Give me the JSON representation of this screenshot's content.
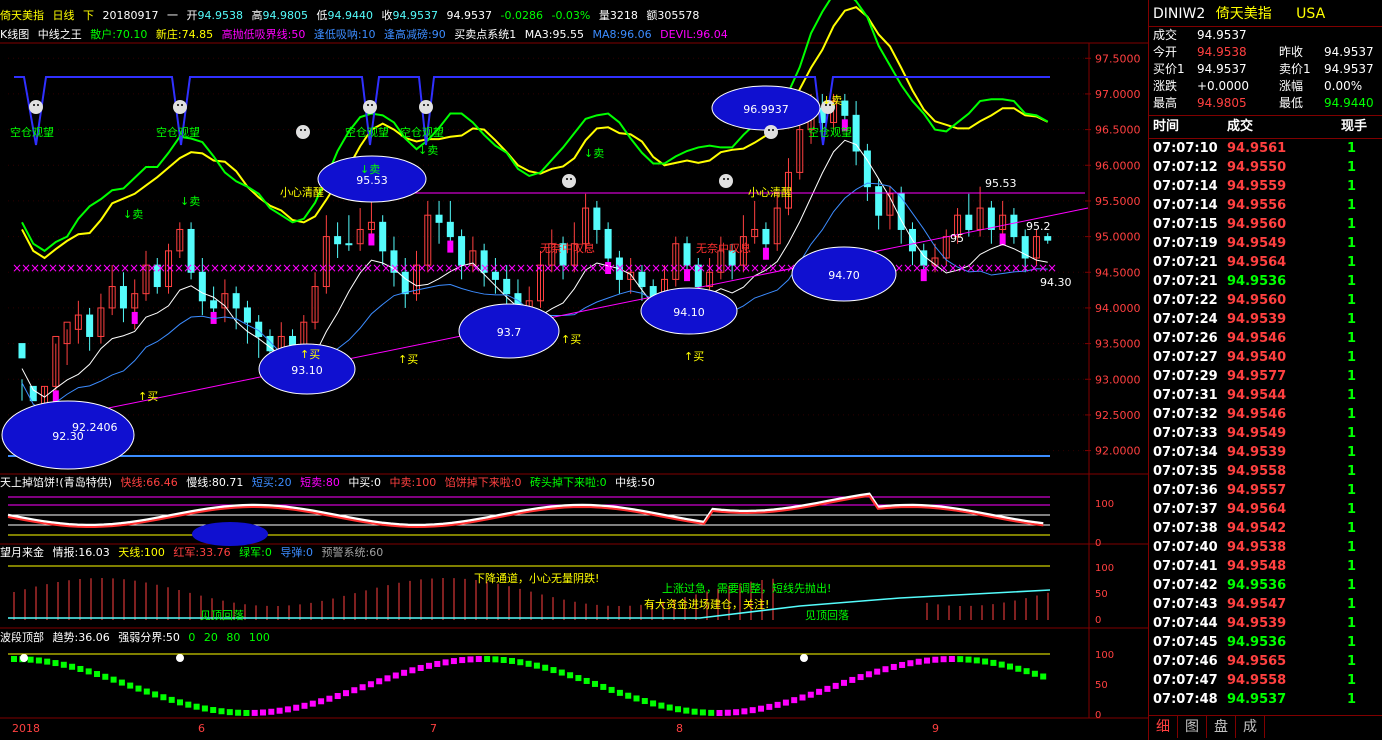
{
  "colors": {
    "up": "#ff4040",
    "down": "#54fcfc",
    "bull": "#ff3030",
    "bear": "#00ff00",
    "yellow": "#ffff00",
    "magenta": "#ff00ff",
    "grid": "#800000",
    "blue": "#3030ff"
  },
  "header": {
    "name": "倚天美指",
    "period": "日线",
    "mode": "下",
    "date": "20180917",
    "weekday": "一",
    "open_label": "开",
    "open": "94.9538",
    "high_label": "高",
    "high": "94.9805",
    "low_label": "低",
    "low": "94.9440",
    "close_label": "收",
    "close": "94.9537",
    "last": "94.9537",
    "change": "-0.0286",
    "change_pct": "-0.03%",
    "volume_label": "量",
    "volume": "3218",
    "amount_label": "额",
    "amount": "305578"
  },
  "indicator_main": {
    "prefix": "K线图",
    "name": "中线之王",
    "items": [
      "散户:70.10",
      "新庄:74.85",
      "高抛低吸界线:50",
      "逢低吸呐:10",
      "逢高减磅:90",
      "买卖点系统1",
      "MA3:95.55",
      "MA8:96.06",
      "DEVIL:96.04"
    ]
  },
  "price_axis": [
    "97.5000",
    "97.0000",
    "96.5000",
    "96.0000",
    "95.5000",
    "95.0000",
    "94.5000",
    "94.0000",
    "93.5000",
    "93.0000",
    "92.5000",
    "92.0000"
  ],
  "annotations": [
    {
      "text": "空仓观望",
      "kind": "green"
    },
    {
      "text": "空仓观望",
      "kind": "green"
    },
    {
      "text": "空仓观望",
      "kind": "green"
    },
    {
      "text": "空仓观望",
      "kind": "green"
    },
    {
      "text": "空仓观望",
      "kind": "green"
    },
    {
      "text": "小心清醒",
      "kind": "yellow"
    },
    {
      "text": "小心清醒",
      "kind": "yellow"
    },
    {
      "text": "无奈中叹息",
      "kind": "red"
    },
    {
      "text": "无奈中叹息",
      "kind": "red"
    },
    {
      "text": "↓卖",
      "kind": "green"
    },
    {
      "text": "↓卖",
      "kind": "green"
    },
    {
      "text": "↓卖",
      "kind": "green"
    },
    {
      "text": "↓卖",
      "kind": "green"
    },
    {
      "text": "↓卖",
      "kind": "green"
    },
    {
      "text": "↑买",
      "kind": "yellow"
    },
    {
      "text": "↑买",
      "kind": "yellow"
    },
    {
      "text": "↑买",
      "kind": "yellow"
    },
    {
      "text": "↑买",
      "kind": "yellow"
    },
    {
      "text": "↑买",
      "kind": "yellow"
    },
    {
      "text": "↓卖",
      "kind": "white"
    }
  ],
  "ellipse_labels": [
    "92.30",
    "93.10",
    "93.7",
    "94.10",
    "94.70",
    "95.53",
    "96.9937"
  ],
  "price_labels": [
    "92.2406",
    "95.53",
    "95.2",
    "95",
    "94.30"
  ],
  "panel2": {
    "title": "天上掉馅饼!(青岛特供)",
    "items": [
      "快线:66.46",
      "慢线:80.71",
      "短买:20",
      "短卖:80",
      "中买:0",
      "中卖:100",
      "馅饼掉下来啦:0",
      "砖头掉下来啦:0",
      "中线:50"
    ],
    "axis": [
      "100",
      "0"
    ]
  },
  "panel3": {
    "title": "望月来金",
    "items": [
      "情报:16.03",
      "天线:100",
      "红军:33.76",
      "绿军:0",
      "导弹:0",
      "预警系统:60"
    ],
    "axis": [
      "100",
      "50",
      "0"
    ],
    "notes": [
      "下降通道，小心无量阴跌!",
      "上涨过急，需要调整，短线先抛出!",
      "有大资金进场建仓，关注!",
      "见顶回落",
      "见顶回落"
    ]
  },
  "panel4": {
    "title": "波段顶部",
    "items": [
      "趋势:36.06",
      "强弱分界:50",
      "0",
      "20",
      "80",
      "100"
    ],
    "axis": [
      "100",
      "50",
      "0"
    ]
  },
  "x_axis": [
    "2018",
    "6",
    "7",
    "8",
    "9"
  ],
  "right": {
    "symbol": "DINIW2",
    "name": "倚天美指",
    "market": "USA",
    "quote": {
      "last_label": "成交",
      "last": "94.9537",
      "open_label": "今开",
      "open": "94.9538",
      "prev_label": "昨收",
      "prev": "94.9537",
      "bid_label": "买价1",
      "bid": "94.9537",
      "ask_label": "卖价1",
      "ask": "94.9537",
      "chg_label": "涨跌",
      "chg": "+0.0000",
      "chgpct_label": "涨幅",
      "chgpct": "0.00%",
      "high_label": "最高",
      "high": "94.9805",
      "low_label": "最低",
      "low": "94.9440"
    },
    "head": {
      "time": "时间",
      "price": "成交",
      "hand": "现手"
    },
    "ticks": [
      {
        "time": "07:07:10",
        "price": "94.9561",
        "hand": "1",
        "dir": "up"
      },
      {
        "time": "07:07:12",
        "price": "94.9550",
        "hand": "1",
        "dir": "up"
      },
      {
        "time": "07:07:14",
        "price": "94.9559",
        "hand": "1",
        "dir": "up"
      },
      {
        "time": "07:07:14",
        "price": "94.9556",
        "hand": "1",
        "dir": "up"
      },
      {
        "time": "07:07:15",
        "price": "94.9560",
        "hand": "1",
        "dir": "up"
      },
      {
        "time": "07:07:19",
        "price": "94.9549",
        "hand": "1",
        "dir": "up"
      },
      {
        "time": "07:07:21",
        "price": "94.9564",
        "hand": "1",
        "dir": "up"
      },
      {
        "time": "07:07:21",
        "price": "94.9536",
        "hand": "1",
        "dir": "down"
      },
      {
        "time": "07:07:22",
        "price": "94.9560",
        "hand": "1",
        "dir": "up"
      },
      {
        "time": "07:07:24",
        "price": "94.9539",
        "hand": "1",
        "dir": "up"
      },
      {
        "time": "07:07:26",
        "price": "94.9546",
        "hand": "1",
        "dir": "up"
      },
      {
        "time": "07:07:27",
        "price": "94.9540",
        "hand": "1",
        "dir": "up"
      },
      {
        "time": "07:07:29",
        "price": "94.9577",
        "hand": "1",
        "dir": "up"
      },
      {
        "time": "07:07:31",
        "price": "94.9544",
        "hand": "1",
        "dir": "up"
      },
      {
        "time": "07:07:32",
        "price": "94.9546",
        "hand": "1",
        "dir": "up"
      },
      {
        "time": "07:07:33",
        "price": "94.9549",
        "hand": "1",
        "dir": "up"
      },
      {
        "time": "07:07:34",
        "price": "94.9539",
        "hand": "1",
        "dir": "up"
      },
      {
        "time": "07:07:35",
        "price": "94.9558",
        "hand": "1",
        "dir": "up"
      },
      {
        "time": "07:07:36",
        "price": "94.9557",
        "hand": "1",
        "dir": "up"
      },
      {
        "time": "07:07:37",
        "price": "94.9564",
        "hand": "1",
        "dir": "up"
      },
      {
        "time": "07:07:38",
        "price": "94.9542",
        "hand": "1",
        "dir": "up"
      },
      {
        "time": "07:07:40",
        "price": "94.9538",
        "hand": "1",
        "dir": "up"
      },
      {
        "time": "07:07:41",
        "price": "94.9548",
        "hand": "1",
        "dir": "up"
      },
      {
        "time": "07:07:42",
        "price": "94.9536",
        "hand": "1",
        "dir": "down"
      },
      {
        "time": "07:07:43",
        "price": "94.9547",
        "hand": "1",
        "dir": "up"
      },
      {
        "time": "07:07:44",
        "price": "94.9539",
        "hand": "1",
        "dir": "up"
      },
      {
        "time": "07:07:45",
        "price": "94.9536",
        "hand": "1",
        "dir": "down"
      },
      {
        "time": "07:07:46",
        "price": "94.9565",
        "hand": "1",
        "dir": "up"
      },
      {
        "time": "07:07:47",
        "price": "94.9558",
        "hand": "1",
        "dir": "up"
      },
      {
        "time": "07:07:48",
        "price": "94.9537",
        "hand": "1",
        "dir": "down"
      }
    ],
    "tabs": [
      "细",
      "图",
      "盘",
      "成"
    ]
  },
  "chart_data": {
    "type": "candlestick",
    "ylim": [
      91.7,
      97.7
    ],
    "bars": [
      [
        93.3,
        93.5,
        93.0,
        92.7,
        "dn"
      ],
      [
        92.7,
        92.9,
        92.4,
        92.3,
        "dn"
      ],
      [
        92.6,
        92.9,
        92.9,
        92.5,
        "up"
      ],
      [
        92.9,
        93.6,
        93.5,
        92.8,
        "up"
      ],
      [
        93.5,
        93.8,
        93.7,
        93.2,
        "up"
      ],
      [
        93.7,
        93.9,
        94.1,
        93.5,
        "up"
      ],
      [
        93.9,
        93.6,
        94.0,
        93.4,
        "dn"
      ],
      [
        93.6,
        94.0,
        94.2,
        93.5,
        "up"
      ],
      [
        94.0,
        94.3,
        94.6,
        93.9,
        "up"
      ],
      [
        94.3,
        94.0,
        94.5,
        93.8,
        "dn"
      ],
      [
        94.0,
        94.2,
        94.4,
        93.7,
        "up"
      ],
      [
        94.2,
        94.6,
        94.8,
        94.1,
        "up"
      ],
      [
        94.6,
        94.3,
        94.7,
        94.2,
        "dn"
      ],
      [
        94.3,
        94.8,
        94.9,
        94.2,
        "up"
      ],
      [
        94.8,
        95.1,
        95.2,
        94.7,
        "up"
      ],
      [
        95.1,
        94.5,
        95.2,
        94.4,
        "dn"
      ],
      [
        94.5,
        94.1,
        94.7,
        93.9,
        "dn"
      ],
      [
        94.1,
        94.0,
        94.3,
        93.8,
        "dn"
      ],
      [
        94.0,
        94.2,
        94.4,
        93.8,
        "up"
      ],
      [
        94.2,
        94.0,
        94.3,
        93.7,
        "dn"
      ],
      [
        94.0,
        93.8,
        94.1,
        93.5,
        "dn"
      ],
      [
        93.8,
        93.6,
        93.9,
        93.3,
        "dn"
      ],
      [
        93.6,
        93.4,
        93.7,
        93.2,
        "dn"
      ],
      [
        93.4,
        93.6,
        93.8,
        93.3,
        "up"
      ],
      [
        93.6,
        93.4,
        93.7,
        93.2,
        "dn"
      ],
      [
        93.4,
        93.8,
        93.9,
        93.3,
        "up"
      ],
      [
        93.8,
        94.3,
        94.5,
        93.7,
        "up"
      ],
      [
        94.3,
        95.0,
        95.3,
        94.2,
        "up"
      ],
      [
        95.0,
        94.9,
        95.2,
        94.7,
        "dn"
      ],
      [
        94.9,
        94.9,
        95.3,
        94.8,
        "dn"
      ],
      [
        94.9,
        95.1,
        95.4,
        94.8,
        "up"
      ],
      [
        95.1,
        95.2,
        95.6,
        95.0,
        "up"
      ],
      [
        95.2,
        94.8,
        95.3,
        94.6,
        "dn"
      ],
      [
        94.8,
        94.5,
        95.0,
        94.3,
        "dn"
      ],
      [
        94.5,
        94.2,
        94.7,
        94.0,
        "dn"
      ],
      [
        94.2,
        94.6,
        94.8,
        94.1,
        "up"
      ],
      [
        94.6,
        95.3,
        95.5,
        94.5,
        "up"
      ],
      [
        95.3,
        95.2,
        95.5,
        94.9,
        "dn"
      ],
      [
        95.2,
        95.0,
        95.5,
        94.8,
        "dn"
      ],
      [
        95.0,
        94.6,
        95.1,
        94.4,
        "dn"
      ],
      [
        94.6,
        94.8,
        95.0,
        94.5,
        "up"
      ],
      [
        94.8,
        94.5,
        94.9,
        94.3,
        "dn"
      ],
      [
        94.5,
        94.4,
        94.7,
        94.2,
        "dn"
      ],
      [
        94.4,
        94.2,
        94.6,
        94.0,
        "dn"
      ],
      [
        94.2,
        93.9,
        94.4,
        93.7,
        "dn"
      ],
      [
        93.9,
        94.1,
        94.3,
        93.8,
        "up"
      ],
      [
        94.1,
        94.6,
        94.8,
        94.0,
        "up"
      ],
      [
        94.6,
        94.9,
        95.1,
        94.5,
        "up"
      ],
      [
        94.9,
        94.6,
        95.0,
        94.4,
        "dn"
      ],
      [
        94.6,
        94.9,
        95.2,
        94.5,
        "up"
      ],
      [
        94.9,
        95.4,
        95.6,
        94.8,
        "up"
      ],
      [
        95.4,
        95.1,
        95.5,
        94.9,
        "dn"
      ],
      [
        95.1,
        94.7,
        95.2,
        94.5,
        "dn"
      ],
      [
        94.7,
        94.4,
        94.8,
        94.2,
        "dn"
      ],
      [
        94.4,
        94.5,
        94.7,
        94.2,
        "up"
      ],
      [
        94.5,
        94.3,
        94.6,
        94.1,
        "dn"
      ],
      [
        94.3,
        94.1,
        94.4,
        93.9,
        "dn"
      ],
      [
        94.1,
        94.4,
        94.6,
        94.0,
        "up"
      ],
      [
        94.4,
        94.9,
        95.0,
        94.3,
        "up"
      ],
      [
        94.9,
        94.6,
        95.0,
        94.4,
        "dn"
      ],
      [
        94.6,
        94.3,
        94.7,
        94.1,
        "dn"
      ],
      [
        94.3,
        94.5,
        94.7,
        94.2,
        "up"
      ],
      [
        94.5,
        94.8,
        95.0,
        94.4,
        "up"
      ],
      [
        94.8,
        94.6,
        94.9,
        94.4,
        "dn"
      ],
      [
        94.6,
        95.0,
        95.3,
        94.5,
        "up"
      ],
      [
        95.0,
        95.1,
        95.5,
        94.9,
        "up"
      ],
      [
        95.1,
        94.9,
        95.2,
        94.7,
        "dn"
      ],
      [
        94.9,
        95.4,
        95.6,
        94.8,
        "up"
      ],
      [
        95.4,
        95.9,
        96.1,
        95.3,
        "up"
      ],
      [
        95.9,
        96.5,
        96.7,
        95.8,
        "up"
      ],
      [
        96.5,
        96.8,
        97.0,
        96.3,
        "up"
      ],
      [
        96.8,
        96.6,
        97.0,
        96.4,
        "dn"
      ],
      [
        96.6,
        96.9,
        97.0,
        96.5,
        "up"
      ],
      [
        96.9,
        96.7,
        97.0,
        96.5,
        "dn"
      ],
      [
        96.7,
        96.2,
        96.9,
        96.0,
        "dn"
      ],
      [
        96.2,
        95.7,
        96.3,
        95.5,
        "dn"
      ],
      [
        95.7,
        95.3,
        95.8,
        95.1,
        "dn"
      ],
      [
        95.3,
        95.6,
        95.7,
        95.1,
        "up"
      ],
      [
        95.6,
        95.1,
        95.7,
        94.9,
        "dn"
      ],
      [
        95.1,
        94.8,
        95.2,
        94.6,
        "dn"
      ],
      [
        94.8,
        94.6,
        94.9,
        94.4,
        "dn"
      ],
      [
        94.6,
        94.7,
        94.9,
        94.5,
        "up"
      ],
      [
        94.7,
        95.0,
        95.1,
        94.6,
        "up"
      ],
      [
        95.0,
        95.3,
        95.4,
        94.9,
        "up"
      ],
      [
        95.3,
        95.1,
        95.6,
        95.0,
        "dn"
      ],
      [
        95.1,
        95.4,
        95.7,
        95.0,
        "up"
      ],
      [
        95.4,
        95.1,
        95.5,
        94.9,
        "dn"
      ],
      [
        95.1,
        95.3,
        95.5,
        95.0,
        "up"
      ],
      [
        95.3,
        95.0,
        95.4,
        94.9,
        "dn"
      ],
      [
        95.0,
        94.7,
        95.1,
        94.5,
        "dn"
      ],
      [
        94.7,
        95.0,
        95.1,
        94.6,
        "up"
      ],
      [
        95.0,
        94.95,
        95.05,
        94.9,
        "dn"
      ]
    ]
  }
}
